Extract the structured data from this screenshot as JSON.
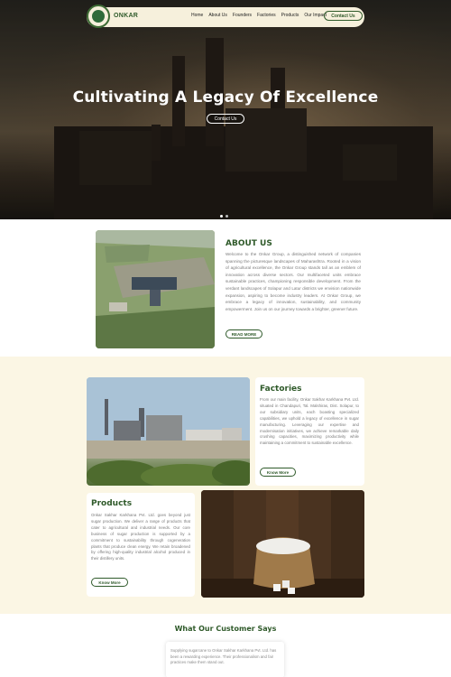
{
  "header": {
    "brand": "ONKAR",
    "nav": [
      "Home",
      "About Us",
      "Founders",
      "Factories",
      "Products",
      "Our Impact"
    ],
    "cta": "Contact Us"
  },
  "hero": {
    "title": "Cultivating A Legacy Of Excellence",
    "button": "Contact Us",
    "slides": 2,
    "active_slide": 1
  },
  "about": {
    "title": "ABOUT US",
    "text": "Welcome to the Onkar Group, a distinguished network of companies spanning the picturesque landscapes of Maharashtra. Rooted in a vision of agricultural excellence, the Onkar Group stands tall as an emblem of innovation across diverse sectors. Our multifaceted units embrace sustainable practices, championing responsible development. From the verdant landscapes of Solapur and Latur districts we envision nationwide expansion, aspiring to become industry leaders. At Onkar Group, we embrace a legacy of innovation, sustainability, and community empowerment. Join us on our journey towards a brighter, greener future.",
    "button": "READ MORE"
  },
  "factories": {
    "title": "Factories",
    "text": "From our main facility, Onkar Sakhar Karkhana Pvt. Ltd. situated in Chandapuri, Tal. Malshiras, Dist. Solapur, to our subsidiary units, each boasting specialized capabilities, we uphold a legacy of excellence in sugar manufacturing. Leveraging our expertise and modernisation initiatives, we achieve remarkable daily crushing capacities, maximizing productivity while maintaining a commitment to sustainable excellence.",
    "button": "Know More"
  },
  "products": {
    "title": "Products",
    "text": "Onkar Sakhar Karkhana Pvt. Ltd. goes beyond just sugar production. We deliver a range of products that cater to agricultural and industrial needs. Our core business of sugar production is supported by a commitment to sustainability through cogeneration plants that produce clean energy. We retain broadened by offering high-quality industrial alcohol produced in their distillery units.",
    "button": "Know More"
  },
  "testimonials": {
    "title": "What Our Customer Says",
    "quote": "Supplying sugarcane to Onkar Sakhar Karkhana Pvt. Ltd. has been a rewarding experience. Their professionalism and fair practices make them stand out."
  },
  "colors": {
    "brand_green": "#2f5a2a",
    "cream_band": "#fbf6e4",
    "body_text": "#7a7a7a"
  }
}
